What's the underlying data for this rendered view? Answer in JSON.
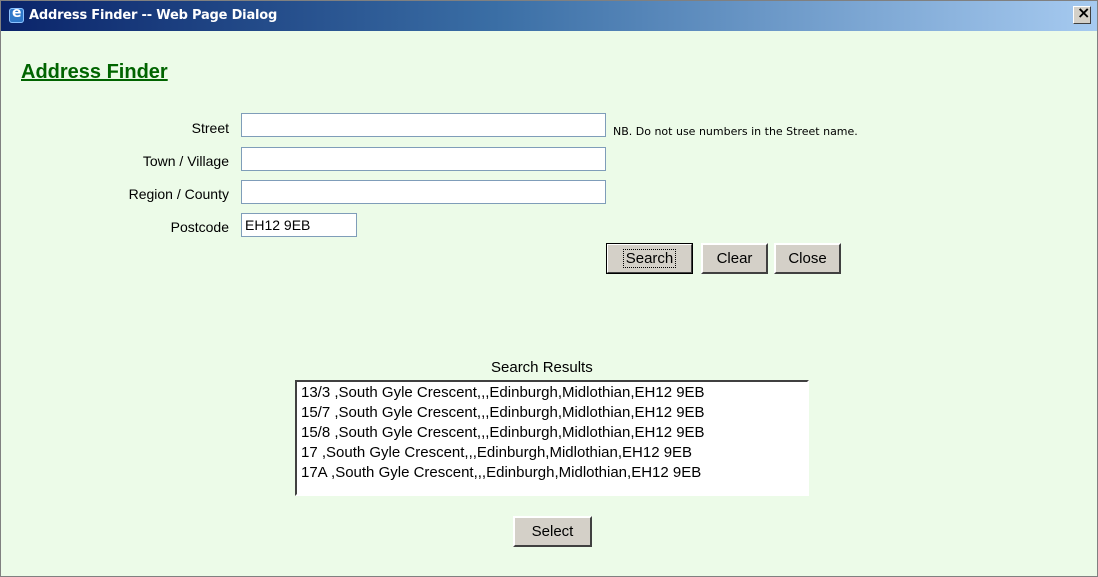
{
  "window": {
    "title": "Address Finder -- Web Page Dialog",
    "close_label": "×"
  },
  "form": {
    "heading": "Address Finder",
    "fields": [
      {
        "label": "Street",
        "value": ""
      },
      {
        "label": "Town / Village",
        "value": ""
      },
      {
        "label": "Region / County",
        "value": ""
      },
      {
        "label": "Postcode",
        "value": "EH12 9EB"
      }
    ],
    "street_note": "NB. Do not use numbers in the Street name."
  },
  "buttons": {
    "search": "Search",
    "clear": "Clear",
    "close": "Close",
    "select": "Select"
  },
  "results": {
    "title": "Search Results",
    "items": [
      "13/3 ,South Gyle Crescent,,,Edinburgh,Midlothian,EH12 9EB",
      "15/7 ,South Gyle Crescent,,,Edinburgh,Midlothian,EH12 9EB",
      "15/8 ,South Gyle Crescent,,,Edinburgh,Midlothian,EH12 9EB",
      "17 ,South Gyle Crescent,,,Edinburgh,Midlothian,EH12 9EB",
      "17A ,South Gyle Crescent,,,Edinburgh,Midlothian,EH12 9EB"
    ]
  }
}
